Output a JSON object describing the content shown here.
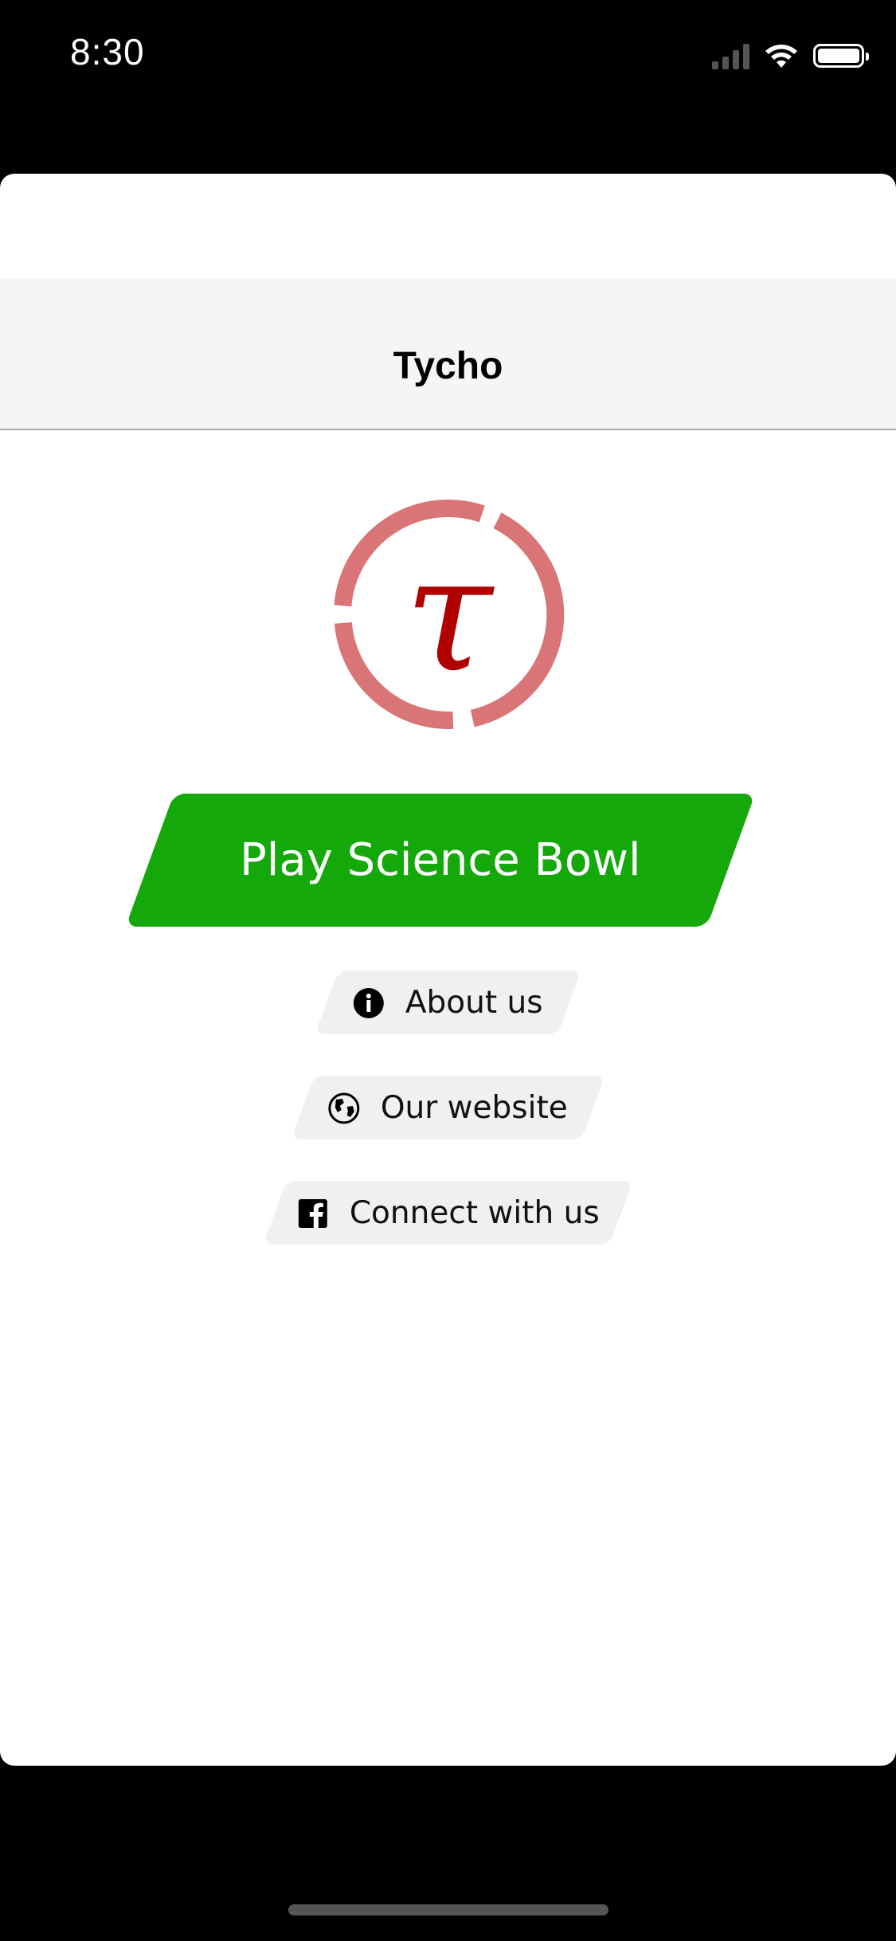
{
  "status_bar": {
    "time": "8:30"
  },
  "navbar": {
    "title": "Tycho"
  },
  "logo": {
    "symbol": "τ",
    "ring_color": "#d97577",
    "symbol_color": "#b00000"
  },
  "play": {
    "label": "Play Science Bowl",
    "color": "#14a80a"
  },
  "links": {
    "about": {
      "label": "About us",
      "icon": "info-icon"
    },
    "website": {
      "label": "Our website",
      "icon": "globe-icon"
    },
    "connect": {
      "label": "Connect with us",
      "icon": "facebook-icon"
    }
  }
}
